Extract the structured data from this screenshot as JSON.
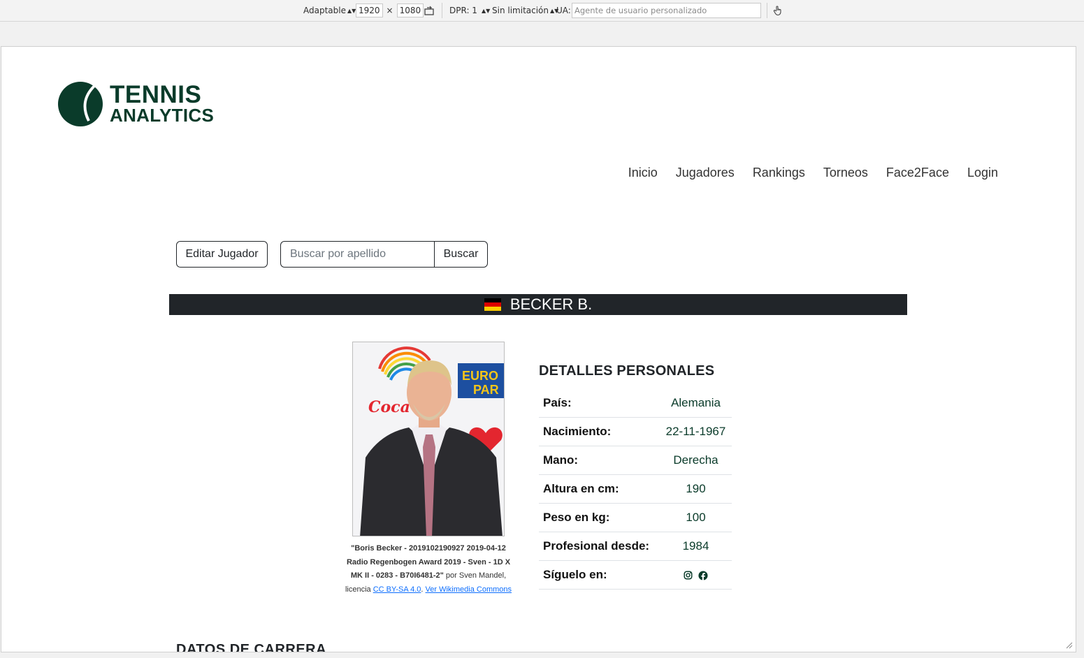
{
  "devtools": {
    "device_label": "Adaptable",
    "width": "1920",
    "times": "×",
    "height": "1080",
    "dpr_label": "DPR: 1",
    "throttle_label": "Sin limitación",
    "ua_label": "UA:",
    "ua_placeholder": "Agente de usuario personalizado"
  },
  "site": {
    "logo_line1": "TENNIS",
    "logo_line2": "ANALYTICS",
    "nav": [
      "Inicio",
      "Jugadores",
      "Rankings",
      "Torneos",
      "Face2Face",
      "Login"
    ],
    "edit_button": "Editar Jugador",
    "search_placeholder": "Buscar por apellido",
    "search_button": "Buscar",
    "player_name": "BECKER B.",
    "flag_colors": [
      "#000000",
      "#dd0000",
      "#ffce00"
    ],
    "caption": {
      "title": "\"Boris Becker - 2019102190927 2019-04-12 Radio Regenbogen Award 2019 - Sven - 1D X MK II - 0283 - B70I6481-2\"",
      "by": " por Sven Mandel, licencia ",
      "license_link": "CC BY-SA 4.0",
      "sep": ". ",
      "wiki_link": "Ver Wikimedia Commons"
    },
    "details_title": "DETALLES PERSONALES",
    "details": [
      {
        "k": "País:",
        "v": "Alemania"
      },
      {
        "k": "Nacimiento:",
        "v": "22-11-1967"
      },
      {
        "k": "Mano:",
        "v": "Derecha"
      },
      {
        "k": "Altura en cm:",
        "v": "190"
      },
      {
        "k": "Peso en kg:",
        "v": "100"
      },
      {
        "k": "Profesional desde:",
        "v": "1984"
      },
      {
        "k": "Síguelo en:",
        "v": ""
      }
    ],
    "social_icons": [
      "instagram-icon",
      "facebook-icon"
    ],
    "next_section": "DATOS DE CARRERA"
  }
}
